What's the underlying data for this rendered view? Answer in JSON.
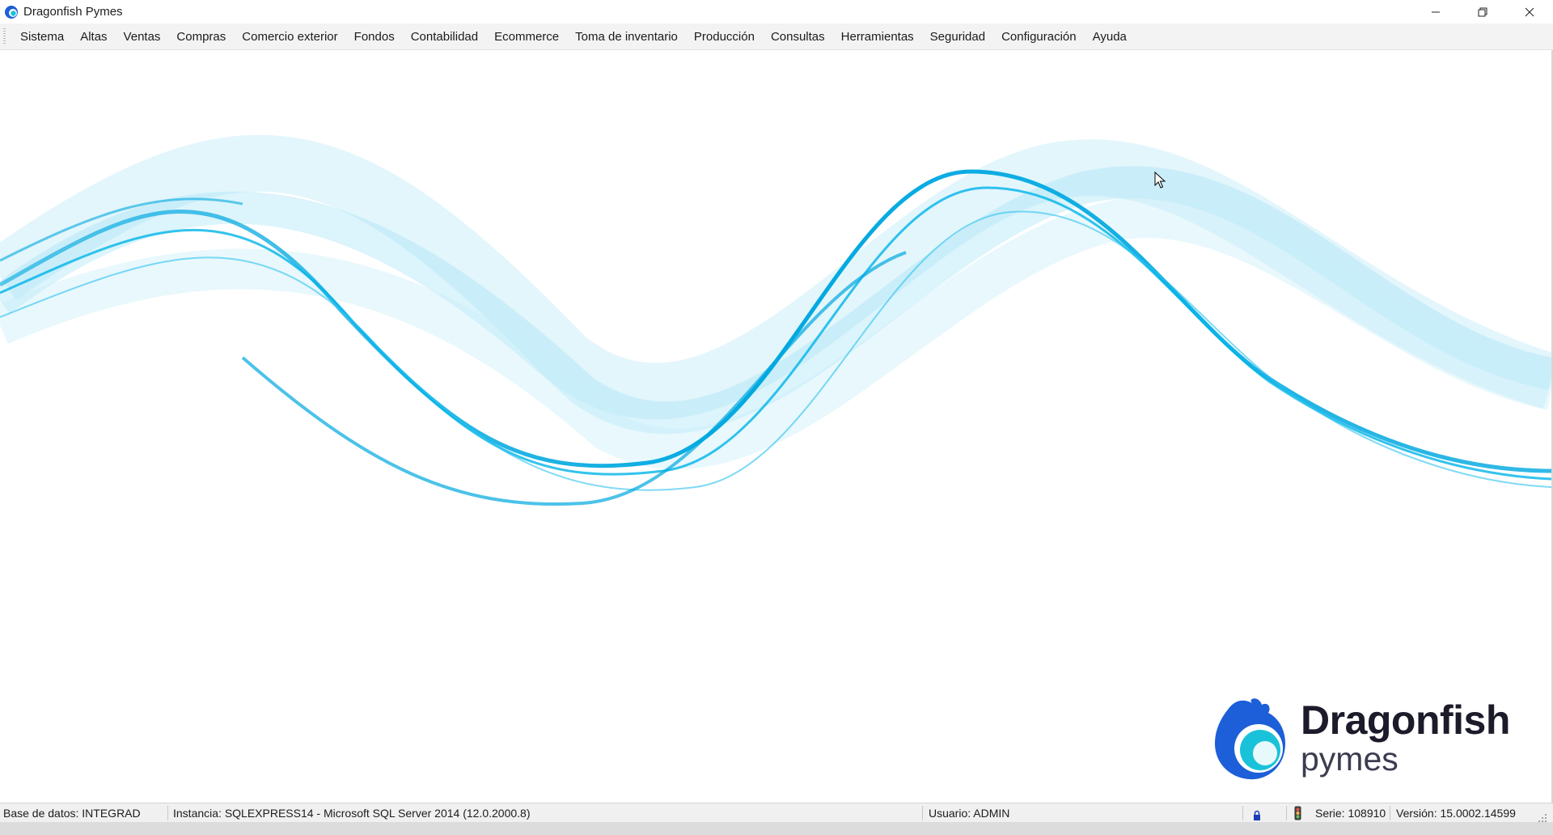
{
  "window": {
    "title": "Dragonfish Pymes",
    "controls": [
      "minimize-icon",
      "restore-icon",
      "close-icon"
    ]
  },
  "menu": {
    "items": [
      {
        "label": "Sistema"
      },
      {
        "label": "Altas"
      },
      {
        "label": "Ventas"
      },
      {
        "label": "Compras"
      },
      {
        "label": "Comercio exterior"
      },
      {
        "label": "Fondos"
      },
      {
        "label": "Contabilidad"
      },
      {
        "label": "Ecommerce"
      },
      {
        "label": "Toma de inventario"
      },
      {
        "label": "Producción"
      },
      {
        "label": "Consultas"
      },
      {
        "label": "Herramientas"
      },
      {
        "label": "Seguridad"
      },
      {
        "label": "Configuración"
      },
      {
        "label": "Ayuda"
      }
    ]
  },
  "logo": {
    "name": "Dragonfish",
    "subtitle": "pymes"
  },
  "status": {
    "database": "Base de datos: INTEGRAD",
    "instance": "Instancia: SQLEXPRESS14 - Microsoft SQL Server 2014 (12.0.2000.8)",
    "user": "Usuario: ADMIN",
    "serial": "Serie: 108910",
    "version": "Versión: 15.0002.14599"
  },
  "colors": {
    "accent": "#00a8e0",
    "wave_light": "#7fd6f2",
    "logo_blue": "#1c5fd8",
    "logo_teal": "#19c2d8"
  }
}
